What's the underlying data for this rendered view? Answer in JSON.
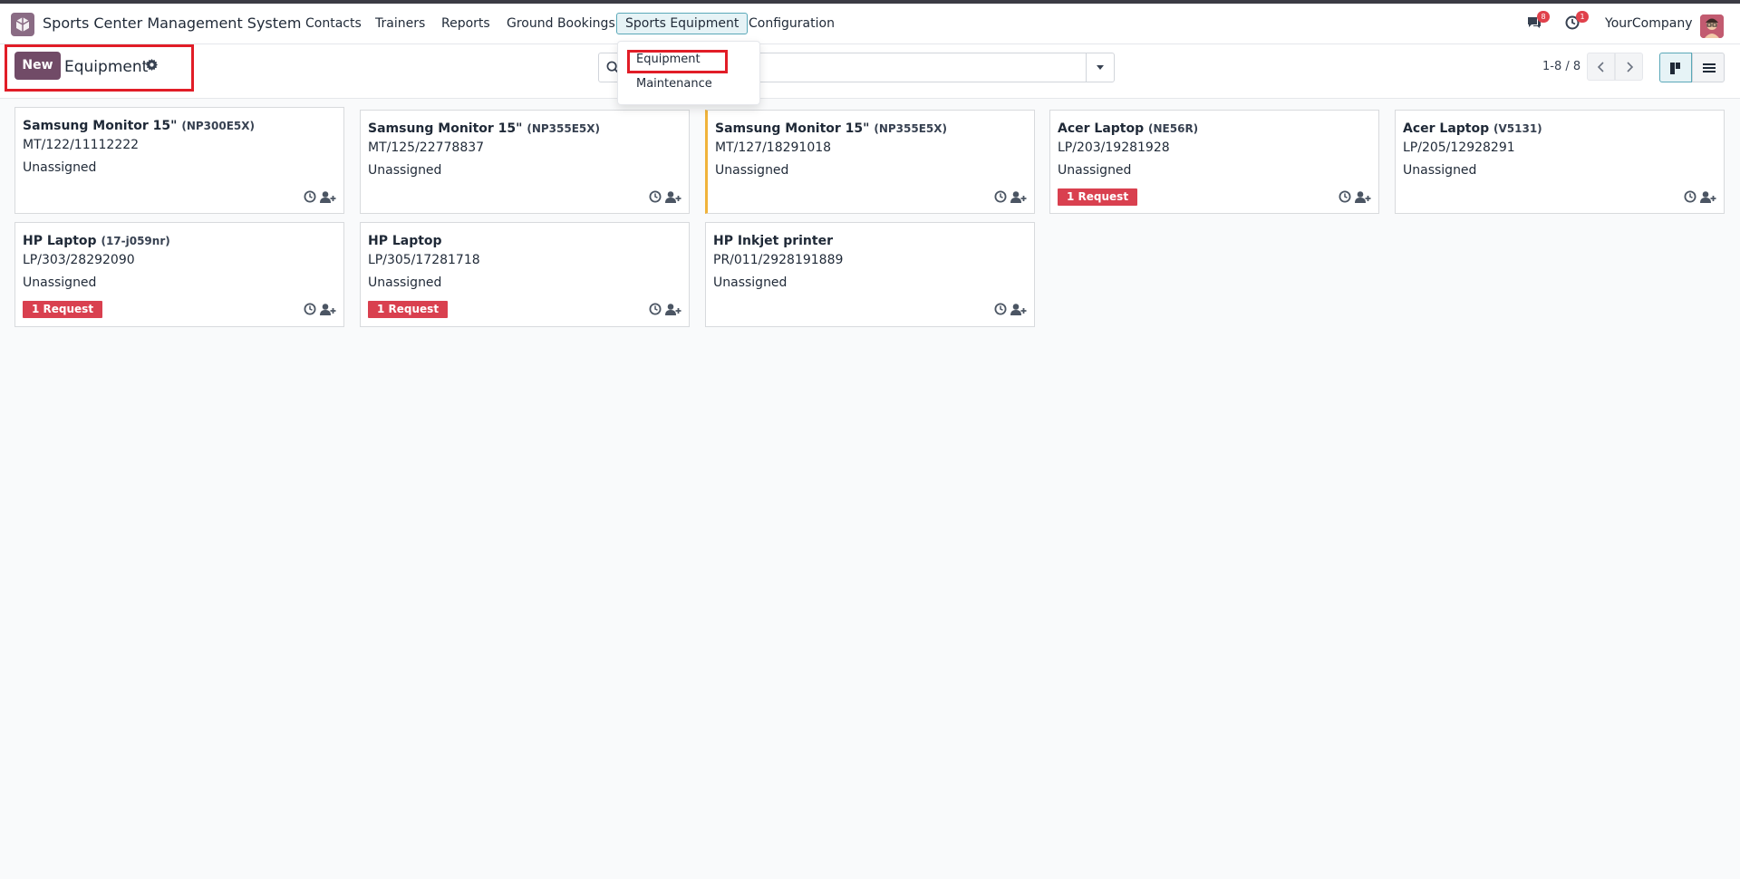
{
  "navbar": {
    "app_name": "Sports Center Management System",
    "menu": [
      {
        "label": "Contacts"
      },
      {
        "label": "Trainers"
      },
      {
        "label": "Reports"
      },
      {
        "label": "Ground Bookings"
      },
      {
        "label": "Sports Equipment"
      },
      {
        "label": "Configuration"
      }
    ],
    "messages_count": "8",
    "activities_count": "1",
    "company": "YourCompany"
  },
  "dropdown": {
    "items": [
      {
        "label": "Equipment"
      },
      {
        "label": "Maintenance"
      }
    ]
  },
  "control_panel": {
    "new_label": "New",
    "title": "Equipment",
    "search_value": "",
    "search_placeholder": "",
    "pager": "1-8 / 8"
  },
  "cards": [
    {
      "name": "Samsung Monitor 15\"",
      "ref": "(NP300E5X)",
      "serial": "MT/122/11112222",
      "owner": "Unassigned",
      "requests": ""
    },
    {
      "name": "Samsung Monitor 15\"",
      "ref": "(NP355E5X)",
      "serial": "MT/125/22778837",
      "owner": "Unassigned",
      "requests": ""
    },
    {
      "name": "Samsung Monitor 15\"",
      "ref": "(NP355E5X)",
      "serial": "MT/127/18291018",
      "owner": "Unassigned",
      "requests": ""
    },
    {
      "name": "Acer Laptop",
      "ref": "(NE56R)",
      "serial": "LP/203/19281928",
      "owner": "Unassigned",
      "requests": "1 Request"
    },
    {
      "name": "Acer Laptop",
      "ref": "(V5131)",
      "serial": "LP/205/12928291",
      "owner": "Unassigned",
      "requests": ""
    },
    {
      "name": "HP Laptop",
      "ref": "(17-j059nr)",
      "serial": "LP/303/28292090",
      "owner": "Unassigned",
      "requests": "1 Request"
    },
    {
      "name": "HP Laptop",
      "ref": "",
      "serial": "LP/305/17281718",
      "owner": "Unassigned",
      "requests": "1 Request"
    },
    {
      "name": "HP Inkjet printer",
      "ref": "",
      "serial": "PR/011/2928191889",
      "owner": "Unassigned",
      "requests": ""
    }
  ],
  "colors": {
    "brand": "#714b67",
    "active_tab": "#e6f3f6",
    "request_badge": "#d9404f",
    "highlight": "#e11d27",
    "warning_stripe": "#f0b33b"
  }
}
